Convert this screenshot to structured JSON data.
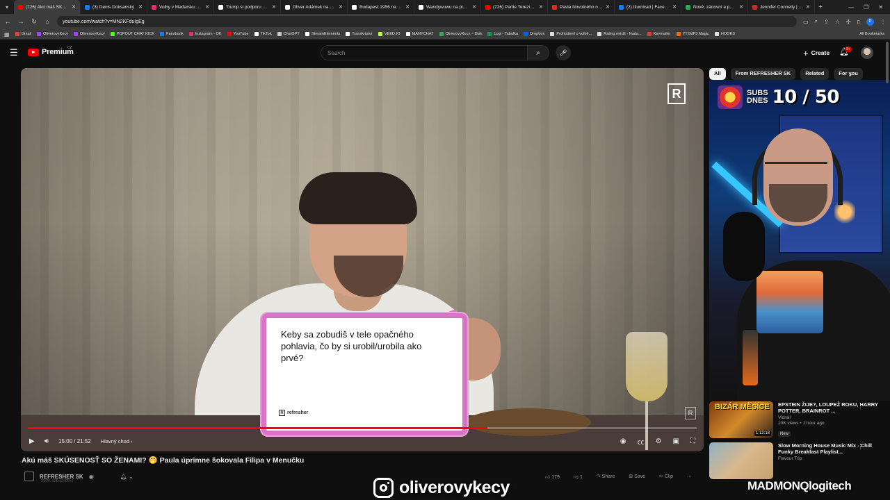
{
  "browser": {
    "tabs": [
      {
        "label": "(726) Akú máš SKÚSENOSŤ SO ŽENAMI",
        "color": "#ff0000",
        "active": true
      },
      {
        "label": "(3) Denis Doksanský",
        "color": "#1877f2",
        "active": false
      },
      {
        "label": "Volby v Maďarsku 2026",
        "color": "#e1306c",
        "active": false
      },
      {
        "label": "Trump si podporu Orbána",
        "color": "#ffffff",
        "active": false
      },
      {
        "label": "Oliver Adámek na platformě X",
        "color": "#ffffff",
        "active": false
      },
      {
        "label": "Budapest 1956 na platformě X",
        "color": "#ffffff",
        "active": false
      },
      {
        "label": "Wandywuwu na platformě X",
        "color": "#ffffff",
        "active": false
      },
      {
        "label": "(726) Partie Terezie Tománkové",
        "color": "#ff0000",
        "active": false
      },
      {
        "label": "Pavla Novotného napadl",
        "color": "#d93025",
        "active": false
      },
      {
        "label": "(2) Illumicati | Facebook",
        "color": "#1877f2",
        "active": false
      },
      {
        "label": "Nové, zánovní a použité",
        "color": "#34a853",
        "active": false
      },
      {
        "label": "Jennifer Connelly | ČSFD",
        "color": "#c4302b",
        "active": false
      }
    ],
    "url": "youtube.com/watch?v=MN2KFduIgEg",
    "profile_initial": "P",
    "bookmarks": [
      {
        "label": "Gmail",
        "color": "#ea4335"
      },
      {
        "label": "OliverovyKecy",
        "color": "#a142f4"
      },
      {
        "label": "OliverovyKecy",
        "color": "#a142f4"
      },
      {
        "label": "POPOUT CHAT KICK",
        "color": "#53fc18"
      },
      {
        "label": "Facebook",
        "color": "#1877f2"
      },
      {
        "label": "Instagram - OK",
        "color": "#e1306c"
      },
      {
        "label": "YouTube",
        "color": "#ff0000"
      },
      {
        "label": "TikTok",
        "color": "#ffffff"
      },
      {
        "label": "ChatGPT",
        "color": "#cccccc"
      },
      {
        "label": "StreamElements",
        "color": "#ffffff"
      },
      {
        "label": "Transkriptor",
        "color": "#ffffff"
      },
      {
        "label": "VEED.IO",
        "color": "#b6f94f"
      },
      {
        "label": "MANYCHAT",
        "color": "#ffffff"
      },
      {
        "label": "OliverovyKecy – Disk",
        "color": "#34a853"
      },
      {
        "label": "Logi - Tabulka",
        "color": "#0f9d58"
      },
      {
        "label": "Dropbox",
        "color": "#0061ff"
      },
      {
        "label": "Prohlášení o volbě...",
        "color": "#dddddd"
      },
      {
        "label": "Rating médií - Nada...",
        "color": "#dddddd"
      },
      {
        "label": "Keymailer",
        "color": "#e53935"
      },
      {
        "label": "YT2MP3 Magic",
        "color": "#ff6a00"
      },
      {
        "label": "HOOKS",
        "color": "#dddddd"
      }
    ],
    "all_bookmarks_label": "All Bookmarks"
  },
  "header": {
    "logo_label": "Premium",
    "region": "CZ",
    "search_placeholder": "Search",
    "create_label": "Create",
    "notifications_badge": "9+"
  },
  "player": {
    "card_text": "Keby sa zobudiš v tele opačného pohlavia, čo by si urobil/urobila ako prvé?",
    "card_brand": "refresher",
    "time": "15:00 / 21:52",
    "chapter": "Hlavný chod",
    "progress_fraction": 0.687
  },
  "video": {
    "title": "Akú máš SKÚSENOSŤ SO ŽENAMI? 🤭 Paula úprimne šokovala Filipa v Menučku",
    "channel": "REFRESHER SK",
    "subscribers": "393K subscribers",
    "like_count": "179",
    "dislike_count": "1",
    "share_label": "Share",
    "save_label": "Save",
    "clip_label": "Clip"
  },
  "sidebar": {
    "chips": [
      "All",
      "From REFRESHER SK",
      "Related",
      "For you"
    ],
    "recommendations": [
      {
        "title": "EPSTEIN ŽIJE?, LOUPEŽ ROKU, HARRY POTTER, BRAINROT ...",
        "channel": "Vidrail",
        "meta": "10K views • 1 hour ago",
        "badge": "New",
        "duration": "1:12:18",
        "thumb_text": "BIZÁR MĚSÍCE"
      },
      {
        "title": "Slow Morning House Music Mix - Chill Funky Breakfast Playlist...",
        "channel": "Flavour Trip",
        "meta": "",
        "badge": "",
        "duration": "",
        "thumb_text": ""
      }
    ]
  },
  "overlay": {
    "subs_label_1": "SUBS",
    "subs_label_2": "DNES",
    "subs_count": "10 / 50",
    "instagram_handle": "oliverovykecy",
    "sponsor": "MADMONQlogitech"
  }
}
